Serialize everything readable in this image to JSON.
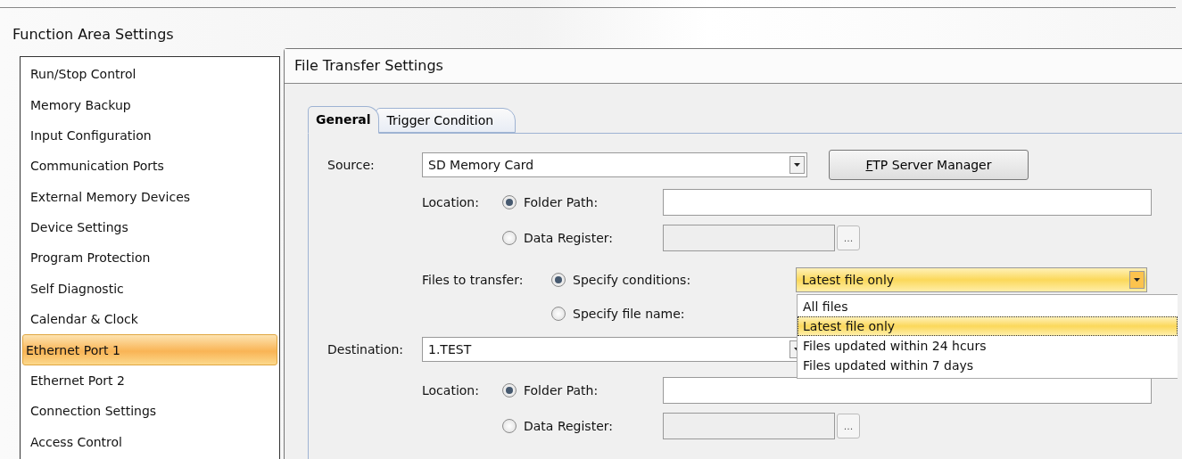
{
  "window": {
    "title": "Function Area Settings"
  },
  "sidebar": {
    "items": [
      {
        "label": "Run/Stop Control",
        "selected": false
      },
      {
        "label": "Memory Backup",
        "selected": false
      },
      {
        "label": "Input Configuration",
        "selected": false
      },
      {
        "label": "Communication Ports",
        "selected": false
      },
      {
        "label": "External Memory Devices",
        "selected": false
      },
      {
        "label": "Device Settings",
        "selected": false
      },
      {
        "label": "Program Protection",
        "selected": false
      },
      {
        "label": "Self Diagnostic",
        "selected": false
      },
      {
        "label": "Calendar & Clock",
        "selected": false
      },
      {
        "label": "Ethernet Port 1",
        "selected": true
      },
      {
        "label": "Ethernet Port 2",
        "selected": false
      },
      {
        "label": "Connection Settings",
        "selected": false
      },
      {
        "label": "Access Control",
        "selected": false
      }
    ]
  },
  "panel": {
    "title": "File Transfer Settings",
    "tabs": [
      {
        "label": "General",
        "selected": true
      },
      {
        "label": "Trigger Condition",
        "selected": false
      }
    ],
    "source": {
      "label": "Source:",
      "value": "SD Memory Card",
      "button": "FTP Server Manager",
      "location": {
        "label": "Location:",
        "options": [
          {
            "kind": "text",
            "label": "Folder Path:",
            "selected": true,
            "disabled": false
          },
          {
            "kind": "register",
            "label": "Data Register:",
            "selected": false,
            "disabled": true,
            "button": "..."
          }
        ]
      }
    },
    "files_to_transfer": {
      "label": "Files to transfer:",
      "options": [
        {
          "label": "Specify conditions:",
          "selected": true
        },
        {
          "label": "Specify file name:",
          "selected": false
        }
      ],
      "combo": {
        "value": "Latest file only",
        "expanded": true,
        "options": [
          {
            "label": "All files",
            "selected": false
          },
          {
            "label": "Latest file only",
            "selected": true
          },
          {
            "label": "Files updated within 24 hcurs",
            "selected": false
          },
          {
            "label": "Files updated within 7 days",
            "selected": false
          }
        ]
      }
    },
    "destination": {
      "label": "Destination:",
      "value": "1.TEST",
      "location": {
        "label": "Location:",
        "options": [
          {
            "kind": "text",
            "label": "Folder Path:",
            "selected": true,
            "disabled": false
          },
          {
            "kind": "register",
            "label": "Data Register:",
            "selected": false,
            "disabled": true,
            "button": "..."
          }
        ]
      }
    }
  }
}
